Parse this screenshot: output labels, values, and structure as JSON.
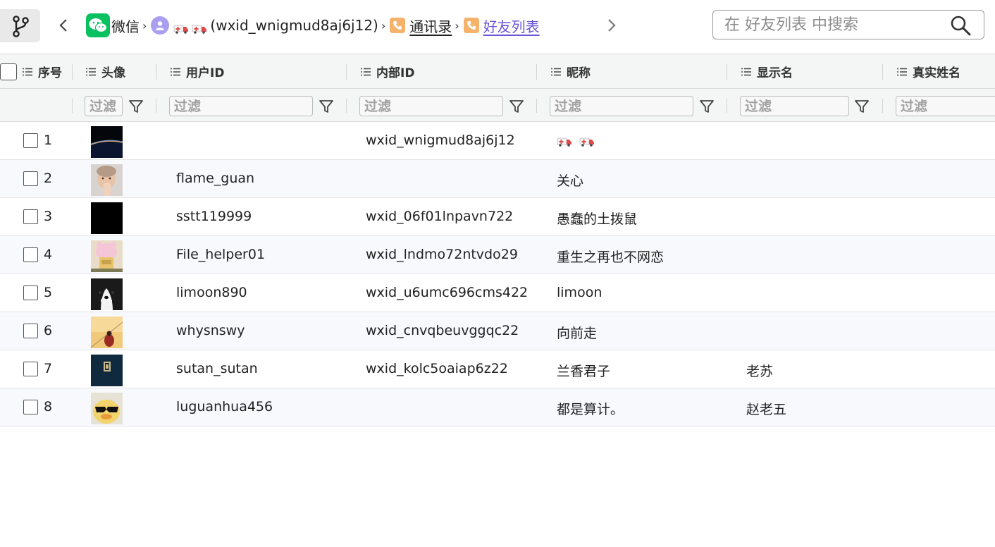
{
  "breadcrumb": {
    "app": "微信",
    "account": "(wxid_wnigmud8aj6j12)",
    "contacts": "通讯录",
    "friends": "好友列表"
  },
  "search": {
    "placeholder": "在 好友列表 中搜索"
  },
  "columns": [
    {
      "label": "序号"
    },
    {
      "label": "头像"
    },
    {
      "label": "用户ID"
    },
    {
      "label": "内部ID"
    },
    {
      "label": "昵称"
    },
    {
      "label": "显示名"
    },
    {
      "label": "真实姓名"
    }
  ],
  "filter_placeholder": "过滤",
  "rows": [
    {
      "index": "1",
      "user_id": "",
      "internal_id": "wxid_wnigmud8aj6j12",
      "nickname": "",
      "display_name": "",
      "real_name": "",
      "avatar": "earth-horizon"
    },
    {
      "index": "2",
      "user_id": "flame_guan",
      "internal_id": "",
      "nickname": "关心",
      "display_name": "",
      "real_name": "",
      "avatar": "baby-photo"
    },
    {
      "index": "3",
      "user_id": "sstt119999",
      "internal_id": "wxid_06f01lnpavn722",
      "nickname": "愚蠢的土拨鼠",
      "display_name": "",
      "real_name": "",
      "avatar": "black"
    },
    {
      "index": "4",
      "user_id": "File_helper01",
      "internal_id": "wxid_lndmo72ntvdo29",
      "nickname": "重生之再也不网恋",
      "display_name": "",
      "real_name": "",
      "avatar": "pink-cartoon"
    },
    {
      "index": "5",
      "user_id": "limoon890",
      "internal_id": "wxid_u6umc696cms422",
      "nickname": "limoon",
      "display_name": "",
      "real_name": "",
      "avatar": "dog"
    },
    {
      "index": "6",
      "user_id": "whysnswy",
      "internal_id": "wxid_cnvqbeuvggqc22",
      "nickname": "向前走",
      "display_name": "",
      "real_name": "",
      "avatar": "sunset"
    },
    {
      "index": "7",
      "user_id": "sutan_sutan",
      "internal_id": "wxid_kolc5oaiap6z22",
      "nickname": "兰香君子",
      "display_name": "老苏",
      "real_name": "",
      "avatar": "dark-blue-book"
    },
    {
      "index": "8",
      "user_id": "luguanhua456",
      "internal_id": "",
      "nickname": "都是算计。",
      "display_name": "赵老五",
      "real_name": "",
      "avatar": "duck-sunglasses"
    }
  ],
  "colors": {
    "accent": "#6a55d6",
    "wechat_green": "#07c160",
    "header_bg": "#f4f5f5",
    "row_alt_bg": "#f8f9fd"
  },
  "icons": [
    "git-branch-icon",
    "chevron-left-icon",
    "chevron-right-icon",
    "wechat-logo-icon",
    "user-icon",
    "ambulance-icon",
    "phone-book-icon",
    "search-icon",
    "list-icon",
    "filter-icon"
  ]
}
